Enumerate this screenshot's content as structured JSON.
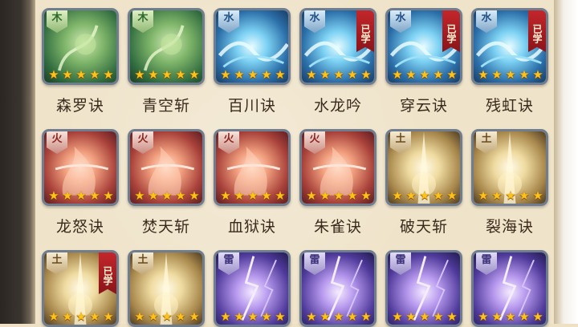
{
  "skills": [
    {
      "name": "森罗诀",
      "element": "木",
      "elem_key": "wood",
      "stars": 5,
      "learned": false
    },
    {
      "name": "青空斩",
      "element": "木",
      "elem_key": "wood",
      "stars": 5,
      "learned": false
    },
    {
      "name": "百川诀",
      "element": "水",
      "elem_key": "water",
      "stars": 5,
      "learned": false
    },
    {
      "name": "水龙吟",
      "element": "水",
      "elem_key": "water",
      "stars": 5,
      "learned": true
    },
    {
      "name": "穿云诀",
      "element": "水",
      "elem_key": "water",
      "stars": 5,
      "learned": true
    },
    {
      "name": "残虹诀",
      "element": "水",
      "elem_key": "water",
      "stars": 5,
      "learned": true
    },
    {
      "name": "龙怒诀",
      "element": "火",
      "elem_key": "fire",
      "stars": 5,
      "learned": false
    },
    {
      "name": "焚天斩",
      "element": "火",
      "elem_key": "fire",
      "stars": 5,
      "learned": false
    },
    {
      "name": "血狱诀",
      "element": "火",
      "elem_key": "fire",
      "stars": 5,
      "learned": false
    },
    {
      "name": "朱雀诀",
      "element": "火",
      "elem_key": "fire",
      "stars": 5,
      "learned": false
    },
    {
      "name": "破天斩",
      "element": "土",
      "elem_key": "earth",
      "stars": 5,
      "learned": false
    },
    {
      "name": "裂海诀",
      "element": "土",
      "elem_key": "earth",
      "stars": 5,
      "learned": false
    },
    {
      "name": "",
      "element": "土",
      "elem_key": "earth",
      "stars": 5,
      "learned": true
    },
    {
      "name": "",
      "element": "土",
      "elem_key": "earth",
      "stars": 5,
      "learned": false
    },
    {
      "name": "",
      "element": "雷",
      "elem_key": "thunder",
      "stars": 5,
      "learned": false
    },
    {
      "name": "",
      "element": "雷",
      "elem_key": "thunder",
      "stars": 5,
      "learned": false
    },
    {
      "name": "",
      "element": "雷",
      "elem_key": "thunder",
      "stars": 5,
      "learned": false
    },
    {
      "name": "",
      "element": "雷",
      "elem_key": "thunder",
      "stars": 5,
      "learned": false
    }
  ],
  "learned_label": "已学",
  "star_glyph": "★",
  "colors": {
    "panel": "#efe3c9",
    "frame": "#6f7d8f",
    "star": "#ffc21a",
    "ribbon": "#c3262b",
    "text": "#3a2a1c"
  }
}
